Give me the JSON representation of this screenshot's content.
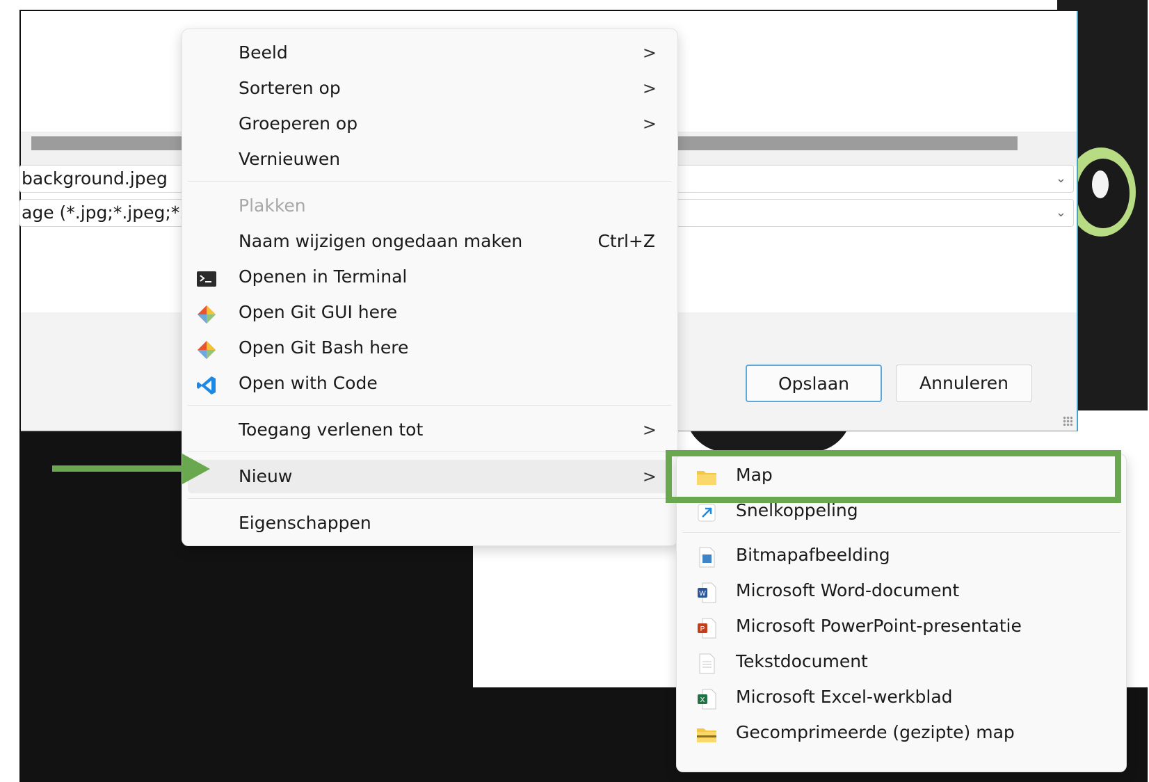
{
  "dialog": {
    "filename_value": "background.jpeg",
    "filetype_value": "age (*.jpg;*.jpeg;*.jfi",
    "save_label": "Opslaan",
    "cancel_label": "Annuleren"
  },
  "context_menu": {
    "items": [
      {
        "label": "Beeld",
        "submenu": true
      },
      {
        "label": "Sorteren op",
        "submenu": true
      },
      {
        "label": "Groeperen op",
        "submenu": true
      },
      {
        "label": "Vernieuwen"
      },
      {
        "label": "Plakken",
        "disabled": true
      },
      {
        "label": "Naam wijzigen ongedaan maken",
        "shortcut": "Ctrl+Z"
      },
      {
        "label": "Openen in Terminal",
        "icon": "terminal-icon"
      },
      {
        "label": "Open Git GUI here",
        "icon": "git-icon"
      },
      {
        "label": "Open Git Bash here",
        "icon": "git-icon"
      },
      {
        "label": "Open with Code",
        "icon": "vscode-icon"
      },
      {
        "label": "Toegang verlenen tot",
        "submenu": true
      },
      {
        "label": "Nieuw",
        "submenu": true,
        "highlighted": true
      },
      {
        "label": "Eigenschappen"
      }
    ],
    "arrow_glyph": ">"
  },
  "new_submenu": {
    "items": [
      {
        "label": "Map",
        "icon": "folder-icon"
      },
      {
        "label": "Snelkoppeling",
        "icon": "shortcut-icon"
      },
      {
        "label": "Bitmapafbeelding",
        "icon": "bitmap-icon"
      },
      {
        "label": "Microsoft Word-document",
        "icon": "word-icon"
      },
      {
        "label": "Microsoft PowerPoint-presentatie",
        "icon": "powerpoint-icon"
      },
      {
        "label": "Tekstdocument",
        "icon": "text-document-icon"
      },
      {
        "label": "Microsoft Excel-werkblad",
        "icon": "excel-icon"
      },
      {
        "label": "Gecomprimeerde (gezipte) map",
        "icon": "zip-folder-icon"
      }
    ]
  },
  "colors": {
    "annotation_green": "#6aa84f",
    "dialog_accent": "#4aa2c8",
    "menu_background": "#f9f9f9"
  }
}
